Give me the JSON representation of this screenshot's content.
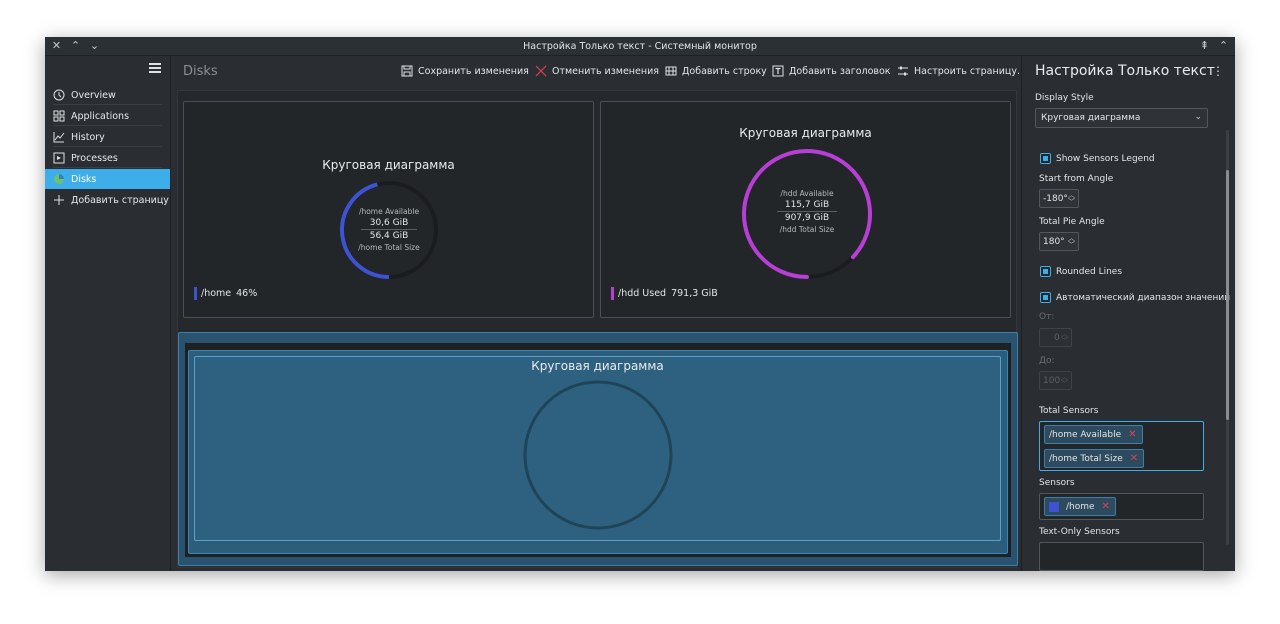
{
  "window": {
    "title": "Настройка Только текст - Системный монитор",
    "controls": {
      "close": "×",
      "minimize": "^",
      "maximize": "v"
    }
  },
  "sidebar": {
    "items": [
      {
        "label": "Overview",
        "icon": "overview-icon"
      },
      {
        "label": "Applications",
        "icon": "applications-grid-icon"
      },
      {
        "label": "History",
        "icon": "history-chart-icon"
      },
      {
        "label": "Processes",
        "icon": "processes-icon"
      },
      {
        "label": "Disks",
        "icon": "disks-icon",
        "active": true
      },
      {
        "label": "Добавить страницу",
        "icon": "plus-icon"
      }
    ]
  },
  "toolbar": {
    "page_title": "Disks",
    "save": "Сохранить изменения",
    "cancel": "Отменить изменения",
    "add_row": "Добавить строку",
    "add_title": "Добавить заголовок",
    "configure_page": "Настроить страницу..."
  },
  "cards": {
    "home": {
      "title": "Круговая диаграмма",
      "top_label": "/home Available",
      "value1": "30,6 GiB",
      "value2": "56,4 GiB",
      "bottom_label": "/home Total Size",
      "legend_name": "/home",
      "legend_value": "46%",
      "fraction": 0.46,
      "color": "#3e53d4"
    },
    "hdd": {
      "title": "Круговая диаграмма",
      "top_label": "/hdd Available",
      "value1": "115,7 GiB",
      "value2": "907,9 GiB",
      "bottom_label": "/hdd Total Size",
      "legend_name": "/hdd Used",
      "legend_value": "791,3 GiB",
      "fraction": 0.87,
      "color": "#b73fd6"
    },
    "selected": {
      "title": "Круговая диаграмма"
    }
  },
  "panel": {
    "title": "Настройка Только текст",
    "display_style_label": "Display Style",
    "display_style_value": "Круговая диаграмма",
    "show_legend": "Show Sensors Legend",
    "start_angle_label": "Start from Angle",
    "start_angle_value": "-180°",
    "total_angle_label": "Total Pie Angle",
    "total_angle_value": "180°",
    "rounded_lines": "Rounded Lines",
    "auto_range": "Автоматический диапазон значений",
    "from_label": "От:",
    "from_value": "0",
    "to_label": "До:",
    "to_value": "100",
    "total_sensors_label": "Total Sensors",
    "total_sensors": [
      "/home Available",
      "/home Total Size"
    ],
    "sensors_label": "Sensors",
    "sensors": [
      "/home"
    ],
    "text_only_label": "Text-Only Sensors"
  },
  "colors": {
    "accent": "#3daee9",
    "home_series": "#3e53d4",
    "hdd_series": "#b73fd6",
    "remove": "#da4453"
  }
}
